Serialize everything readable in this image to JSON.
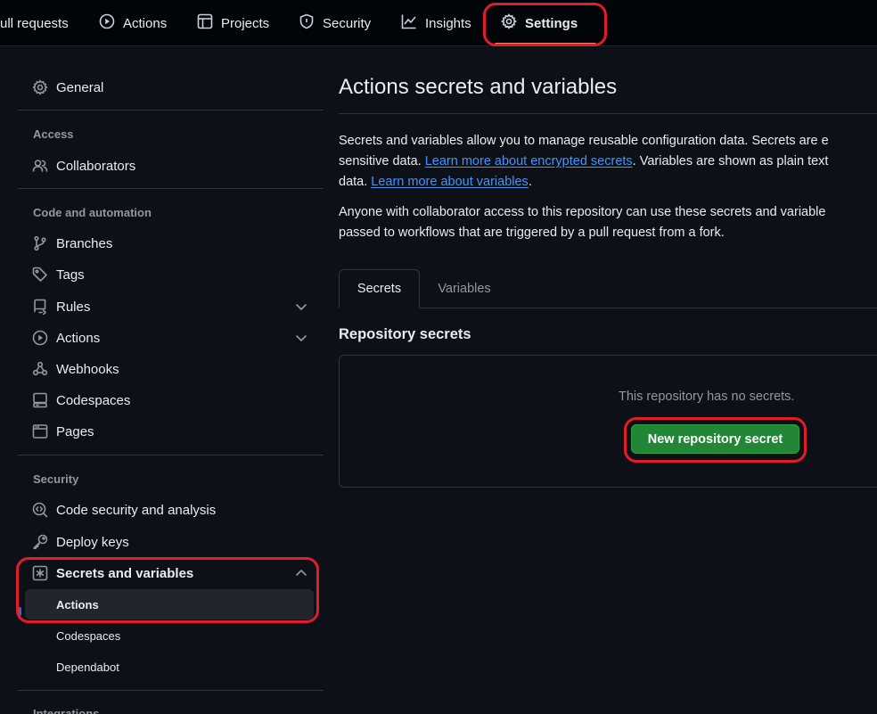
{
  "topnav": {
    "tabs": [
      {
        "label": "ull requests",
        "icon": "pull-request-icon"
      },
      {
        "label": "Actions",
        "icon": "play-circle-icon"
      },
      {
        "label": "Projects",
        "icon": "table-icon"
      },
      {
        "label": "Security",
        "icon": "shield-icon"
      },
      {
        "label": "Insights",
        "icon": "graph-icon"
      },
      {
        "label": "Settings",
        "icon": "gear-icon",
        "selected": true
      }
    ]
  },
  "sidebar": {
    "general": "General",
    "access_heading": "Access",
    "collaborators": "Collaborators",
    "code_heading": "Code and automation",
    "branches": "Branches",
    "tags": "Tags",
    "rules": "Rules",
    "actions": "Actions",
    "webhooks": "Webhooks",
    "codespaces": "Codespaces",
    "pages": "Pages",
    "security_heading": "Security",
    "code_security": "Code security and analysis",
    "deploy_keys": "Deploy keys",
    "secrets_vars": "Secrets and variables",
    "sub_actions": "Actions",
    "sub_codespaces": "Codespaces",
    "sub_dependabot": "Dependabot",
    "integrations_heading": "Integrations"
  },
  "main": {
    "title": "Actions secrets and variables",
    "para1_line1": "Secrets and variables allow you to manage reusable configuration data. Secrets are e",
    "para1_line2_a": "sensitive data. ",
    "para1_link1": "Learn more about encrypted secrets",
    "para1_line2_b": ". Variables are shown as plain text",
    "para1_line3_a": "data. ",
    "para1_link2": "Learn more about variables",
    "para1_line3_b": ".",
    "para2_line1": "Anyone with collaborator access to this repository can use these secrets and variable",
    "para2_line2": "passed to workflows that are triggered by a pull request from a fork.",
    "tab_secrets": "Secrets",
    "tab_variables": "Variables",
    "repo_secrets_title": "Repository secrets",
    "empty_message": "This repository has no secrets.",
    "new_secret_button": "New repository secret"
  },
  "colors": {
    "background": "#0d1117",
    "primary_button": "#238636",
    "link": "#4493f8",
    "annotation": "#e11d2a",
    "tab_underline": "#f78166"
  }
}
